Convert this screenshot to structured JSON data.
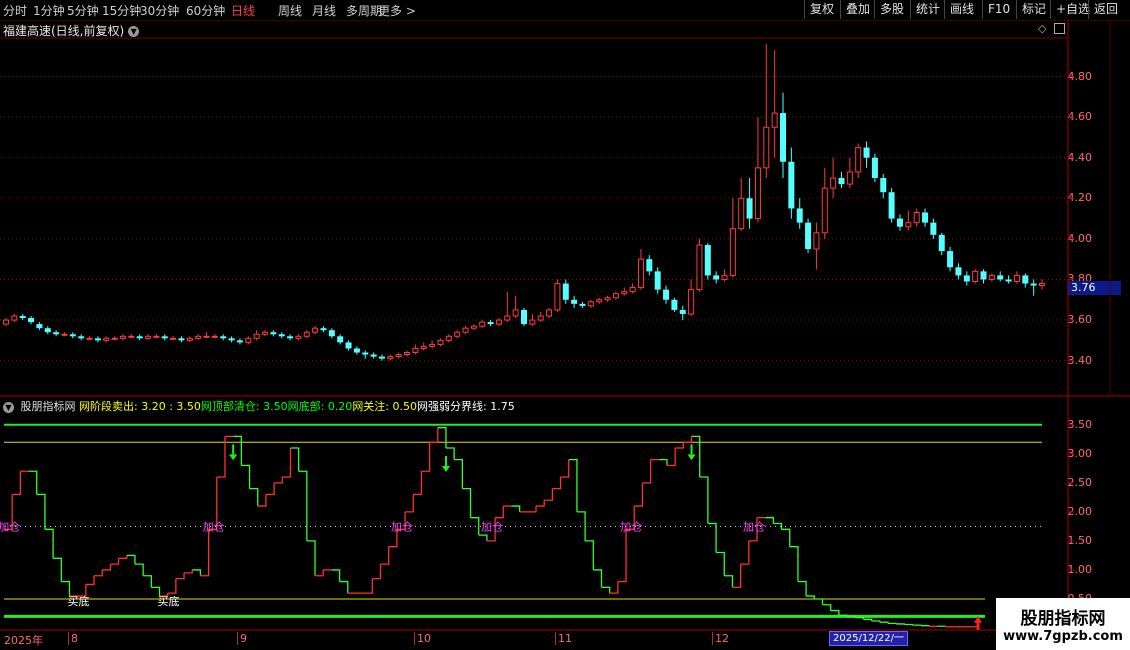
{
  "toolbar": {
    "periods": [
      "分时",
      "1分钟",
      "5分钟",
      "15分钟",
      "30分钟",
      "60分钟",
      "日线",
      "周线",
      "月线",
      "多周期",
      "更多 >"
    ],
    "actions": [
      "复权",
      "叠加",
      "多股",
      "统计",
      "画线",
      "F10",
      "标记",
      "+自选",
      "返回"
    ]
  },
  "stock": {
    "title": "福建高速(日线,前复权)"
  },
  "price_axis": [
    "4.80",
    "4.60",
    "4.40",
    "4.20",
    "4.00",
    "3.80",
    "3.60",
    "3.40"
  ],
  "current_price": "3.76",
  "indicator": {
    "name": "股朋指标网",
    "items": [
      {
        "label": "网阶段卖出: ",
        "value": "3.20",
        "color": "#ffff00"
      },
      {
        "label": " : ",
        "value": "3.50",
        "color": "#ffff00"
      },
      {
        "label": "网顶部清仓: ",
        "value": "3.50",
        "color": "#00ff00"
      },
      {
        "label": "网底部: ",
        "value": "0.20",
        "color": "#00ff00"
      },
      {
        "label": "网关注: ",
        "value": "0.50",
        "color": "#ffff00"
      },
      {
        "label": "网强弱分界线: ",
        "value": "1.75",
        "color": "#ffffff"
      }
    ],
    "axis": [
      "3.50",
      "3.00",
      "2.50",
      "2.00",
      "1.50",
      "1.00",
      "0.50"
    ],
    "labels": {
      "add": "加仓",
      "buy": "买底"
    }
  },
  "dates": {
    "year": "2025年",
    "months": [
      "8",
      "9",
      "10",
      "11",
      "12"
    ],
    "cursor": "2025/12/22/一"
  },
  "watermark": {
    "line1": "股朋指标网",
    "line2": "www.7gpzb.com"
  },
  "colors": {
    "up": "#ff3b3b",
    "down": "#54ffff",
    "ind_up": "#ff3030",
    "ind_down": "#30ff30",
    "bg": "#000000"
  },
  "chart_data": {
    "type": "candlestick",
    "ylim": [
      3.28,
      4.98
    ],
    "candles": [
      [
        3.58,
        3.6,
        3.57,
        3.61
      ],
      [
        3.6,
        3.62,
        3.59,
        3.63
      ],
      [
        3.62,
        3.61,
        3.6,
        3.63
      ],
      [
        3.61,
        3.59,
        3.58,
        3.62
      ],
      [
        3.58,
        3.56,
        3.55,
        3.59
      ],
      [
        3.56,
        3.54,
        3.53,
        3.57
      ],
      [
        3.54,
        3.53,
        3.52,
        3.55
      ],
      [
        3.53,
        3.53,
        3.52,
        3.54
      ],
      [
        3.53,
        3.52,
        3.51,
        3.54
      ],
      [
        3.52,
        3.51,
        3.5,
        3.53
      ],
      [
        3.51,
        3.51,
        3.5,
        3.52
      ],
      [
        3.51,
        3.5,
        3.49,
        3.52
      ],
      [
        3.5,
        3.51,
        3.49,
        3.52
      ],
      [
        3.51,
        3.51,
        3.5,
        3.52
      ],
      [
        3.51,
        3.52,
        3.5,
        3.53
      ],
      [
        3.52,
        3.52,
        3.51,
        3.53
      ],
      [
        3.52,
        3.51,
        3.5,
        3.53
      ],
      [
        3.51,
        3.52,
        3.5,
        3.53
      ],
      [
        3.52,
        3.52,
        3.51,
        3.53
      ],
      [
        3.52,
        3.51,
        3.5,
        3.53
      ],
      [
        3.51,
        3.51,
        3.5,
        3.52
      ],
      [
        3.51,
        3.5,
        3.49,
        3.52
      ],
      [
        3.5,
        3.51,
        3.49,
        3.52
      ],
      [
        3.51,
        3.52,
        3.5,
        3.53
      ],
      [
        3.52,
        3.52,
        3.51,
        3.54
      ],
      [
        3.52,
        3.52,
        3.51,
        3.53
      ],
      [
        3.52,
        3.51,
        3.5,
        3.53
      ],
      [
        3.51,
        3.5,
        3.49,
        3.52
      ],
      [
        3.5,
        3.49,
        3.48,
        3.51
      ],
      [
        3.49,
        3.51,
        3.48,
        3.52
      ],
      [
        3.51,
        3.53,
        3.5,
        3.55
      ],
      [
        3.53,
        3.54,
        3.52,
        3.55
      ],
      [
        3.54,
        3.53,
        3.52,
        3.55
      ],
      [
        3.53,
        3.52,
        3.51,
        3.54
      ],
      [
        3.52,
        3.51,
        3.5,
        3.53
      ],
      [
        3.51,
        3.52,
        3.5,
        3.53
      ],
      [
        3.52,
        3.54,
        3.51,
        3.55
      ],
      [
        3.54,
        3.56,
        3.53,
        3.57
      ],
      [
        3.56,
        3.55,
        3.54,
        3.57
      ],
      [
        3.55,
        3.52,
        3.51,
        3.56
      ],
      [
        3.52,
        3.49,
        3.48,
        3.53
      ],
      [
        3.49,
        3.46,
        3.45,
        3.5
      ],
      [
        3.46,
        3.44,
        3.43,
        3.47
      ],
      [
        3.44,
        3.43,
        3.41,
        3.45
      ],
      [
        3.43,
        3.42,
        3.41,
        3.44
      ],
      [
        3.42,
        3.41,
        3.4,
        3.43
      ],
      [
        3.41,
        3.42,
        3.4,
        3.43
      ],
      [
        3.42,
        3.43,
        3.41,
        3.44
      ],
      [
        3.43,
        3.44,
        3.42,
        3.45
      ],
      [
        3.44,
        3.46,
        3.43,
        3.48
      ],
      [
        3.46,
        3.47,
        3.45,
        3.49
      ],
      [
        3.47,
        3.48,
        3.46,
        3.5
      ],
      [
        3.48,
        3.5,
        3.47,
        3.51
      ],
      [
        3.5,
        3.52,
        3.49,
        3.53
      ],
      [
        3.52,
        3.54,
        3.51,
        3.55
      ],
      [
        3.54,
        3.56,
        3.53,
        3.57
      ],
      [
        3.56,
        3.57,
        3.55,
        3.58
      ],
      [
        3.57,
        3.59,
        3.56,
        3.6
      ],
      [
        3.59,
        3.58,
        3.57,
        3.6
      ],
      [
        3.58,
        3.6,
        3.57,
        3.61
      ],
      [
        3.6,
        3.62,
        3.59,
        3.74
      ],
      [
        3.62,
        3.65,
        3.61,
        3.72
      ],
      [
        3.65,
        3.58,
        3.57,
        3.66
      ],
      [
        3.58,
        3.6,
        3.57,
        3.63
      ],
      [
        3.6,
        3.62,
        3.59,
        3.64
      ],
      [
        3.62,
        3.65,
        3.61,
        3.66
      ],
      [
        3.65,
        3.78,
        3.64,
        3.8
      ],
      [
        3.78,
        3.7,
        3.68,
        3.8
      ],
      [
        3.7,
        3.68,
        3.66,
        3.72
      ],
      [
        3.68,
        3.67,
        3.66,
        3.69
      ],
      [
        3.67,
        3.69,
        3.66,
        3.7
      ],
      [
        3.69,
        3.7,
        3.68,
        3.71
      ],
      [
        3.7,
        3.71,
        3.69,
        3.72
      ],
      [
        3.71,
        3.73,
        3.7,
        3.74
      ],
      [
        3.73,
        3.74,
        3.72,
        3.76
      ],
      [
        3.74,
        3.76,
        3.73,
        3.78
      ],
      [
        3.76,
        3.9,
        3.75,
        3.95
      ],
      [
        3.9,
        3.84,
        3.82,
        3.92
      ],
      [
        3.84,
        3.75,
        3.73,
        3.86
      ],
      [
        3.75,
        3.7,
        3.68,
        3.77
      ],
      [
        3.7,
        3.65,
        3.64,
        3.71
      ],
      [
        3.65,
        3.63,
        3.6,
        3.67
      ],
      [
        3.63,
        3.75,
        3.62,
        3.8
      ],
      [
        3.75,
        3.97,
        3.74,
        4.0
      ],
      [
        3.97,
        3.82,
        3.8,
        3.98
      ],
      [
        3.82,
        3.8,
        3.78,
        3.84
      ],
      [
        3.8,
        3.82,
        3.79,
        3.85
      ],
      [
        3.82,
        4.05,
        3.81,
        4.2
      ],
      [
        4.05,
        4.2,
        4.04,
        4.3
      ],
      [
        4.2,
        4.1,
        4.05,
        4.3
      ],
      [
        4.1,
        4.35,
        4.08,
        4.6
      ],
      [
        4.35,
        4.55,
        4.3,
        4.96
      ],
      [
        4.55,
        4.62,
        4.4,
        4.93
      ],
      [
        4.62,
        4.38,
        4.3,
        4.72
      ],
      [
        4.38,
        4.15,
        4.1,
        4.45
      ],
      [
        4.15,
        4.08,
        4.05,
        4.2
      ],
      [
        4.08,
        3.95,
        3.93,
        4.1
      ],
      [
        3.95,
        4.03,
        3.85,
        4.08
      ],
      [
        4.03,
        4.25,
        4.0,
        4.35
      ],
      [
        4.25,
        4.3,
        4.2,
        4.4
      ],
      [
        4.3,
        4.27,
        4.25,
        4.33
      ],
      [
        4.27,
        4.33,
        4.25,
        4.4
      ],
      [
        4.33,
        4.45,
        4.3,
        4.47
      ],
      [
        4.45,
        4.4,
        4.35,
        4.48
      ],
      [
        4.4,
        4.3,
        4.28,
        4.42
      ],
      [
        4.3,
        4.23,
        4.2,
        4.32
      ],
      [
        4.23,
        4.1,
        4.08,
        4.25
      ],
      [
        4.1,
        4.06,
        4.04,
        4.12
      ],
      [
        4.06,
        4.08,
        4.04,
        4.14
      ],
      [
        4.08,
        4.13,
        4.06,
        4.15
      ],
      [
        4.13,
        4.08,
        4.06,
        4.15
      ],
      [
        4.08,
        4.02,
        4.0,
        4.1
      ],
      [
        4.02,
        3.94,
        3.92,
        4.03
      ],
      [
        3.94,
        3.86,
        3.84,
        3.96
      ],
      [
        3.86,
        3.82,
        3.8,
        3.88
      ],
      [
        3.82,
        3.79,
        3.77,
        3.84
      ],
      [
        3.79,
        3.84,
        3.78,
        3.85
      ],
      [
        3.84,
        3.8,
        3.78,
        3.85
      ],
      [
        3.8,
        3.82,
        3.79,
        3.83
      ],
      [
        3.82,
        3.8,
        3.79,
        3.84
      ],
      [
        3.8,
        3.79,
        3.78,
        3.82
      ],
      [
        3.79,
        3.82,
        3.78,
        3.84
      ],
      [
        3.82,
        3.78,
        3.76,
        3.83
      ],
      [
        3.78,
        3.77,
        3.72,
        3.8
      ],
      [
        3.77,
        3.78,
        3.75,
        3.8
      ]
    ],
    "indicator_ylim": [
      0.0,
      3.72
    ],
    "indicator_values": [
      1.7,
      2.3,
      2.7,
      2.7,
      2.3,
      1.7,
      1.2,
      0.8,
      0.55,
      0.55,
      0.75,
      0.9,
      1.0,
      1.1,
      1.2,
      1.25,
      1.1,
      0.9,
      0.7,
      0.55,
      0.6,
      0.85,
      0.95,
      1.0,
      0.9,
      1.7,
      2.6,
      3.3,
      3.3,
      2.8,
      2.4,
      2.1,
      2.3,
      2.5,
      2.6,
      3.1,
      2.7,
      1.5,
      0.9,
      1.0,
      1.0,
      0.8,
      0.6,
      0.6,
      0.6,
      0.85,
      1.1,
      1.4,
      1.7,
      2.0,
      2.3,
      2.7,
      3.2,
      3.45,
      3.1,
      2.9,
      2.4,
      1.9,
      1.6,
      1.5,
      1.9,
      2.1,
      2.1,
      2.0,
      2.0,
      2.1,
      2.2,
      2.4,
      2.6,
      2.9,
      2.0,
      1.5,
      1.0,
      0.7,
      0.6,
      0.8,
      1.7,
      2.1,
      2.5,
      2.9,
      2.9,
      2.8,
      3.1,
      3.2,
      3.3,
      2.6,
      1.8,
      1.3,
      0.9,
      0.7,
      1.1,
      1.5,
      1.9,
      1.9,
      1.8,
      1.7,
      1.4,
      0.8,
      0.55,
      0.5,
      0.4,
      0.3,
      0.22,
      0.2,
      0.18,
      0.15,
      0.12,
      0.1,
      0.08,
      0.07,
      0.06,
      0.05,
      0.04,
      0.03,
      0.03,
      0.02,
      0.02,
      0.02,
      0.02,
      0.02
    ],
    "reference_lines": [
      3.5,
      3.2,
      1.75,
      0.5,
      0.2
    ]
  }
}
